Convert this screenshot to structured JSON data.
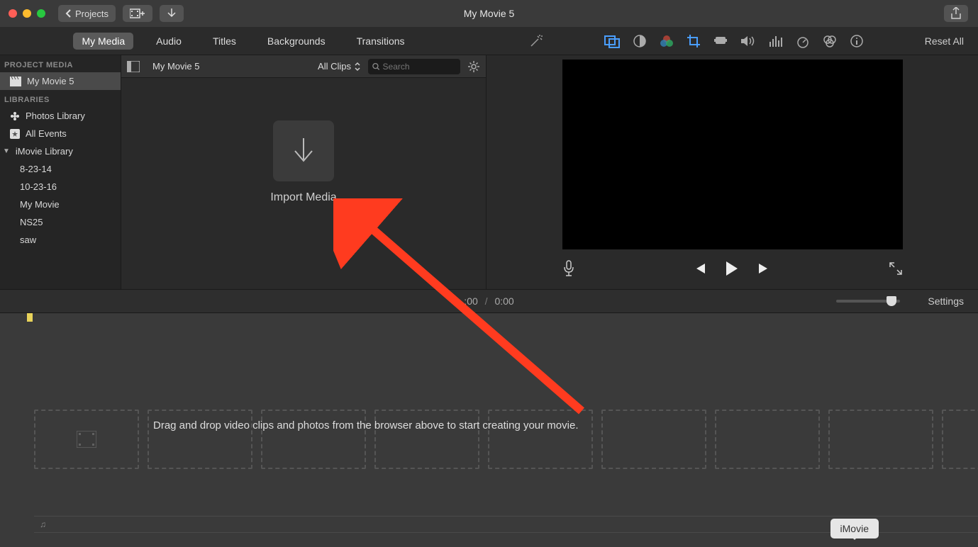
{
  "titlebar": {
    "projects_label": "Projects",
    "window_title": "My Movie 5"
  },
  "tabs": {
    "my_media": "My Media",
    "audio": "Audio",
    "titles": "Titles",
    "backgrounds": "Backgrounds",
    "transitions": "Transitions"
  },
  "adjust": {
    "reset_all": "Reset All"
  },
  "sidebar": {
    "project_media_header": "PROJECT MEDIA",
    "project_name": "My Movie 5",
    "libraries_header": "LIBRARIES",
    "photos_library": "Photos Library",
    "all_events": "All Events",
    "imovie_library": "iMovie Library",
    "events": [
      "8-23-14",
      "10-23-16",
      "My Movie",
      "NS25",
      "saw"
    ]
  },
  "browser": {
    "breadcrumb": "My Movie 5",
    "filter_label": "All Clips",
    "search_placeholder": "Search",
    "import_label": "Import Media"
  },
  "timeline_header": {
    "current_time": ":00",
    "total_time": "0:00",
    "settings_label": "Settings"
  },
  "timeline": {
    "hint": "Drag and drop video clips and photos from the browser above to start creating your movie."
  },
  "dock_tooltip": "iMovie"
}
